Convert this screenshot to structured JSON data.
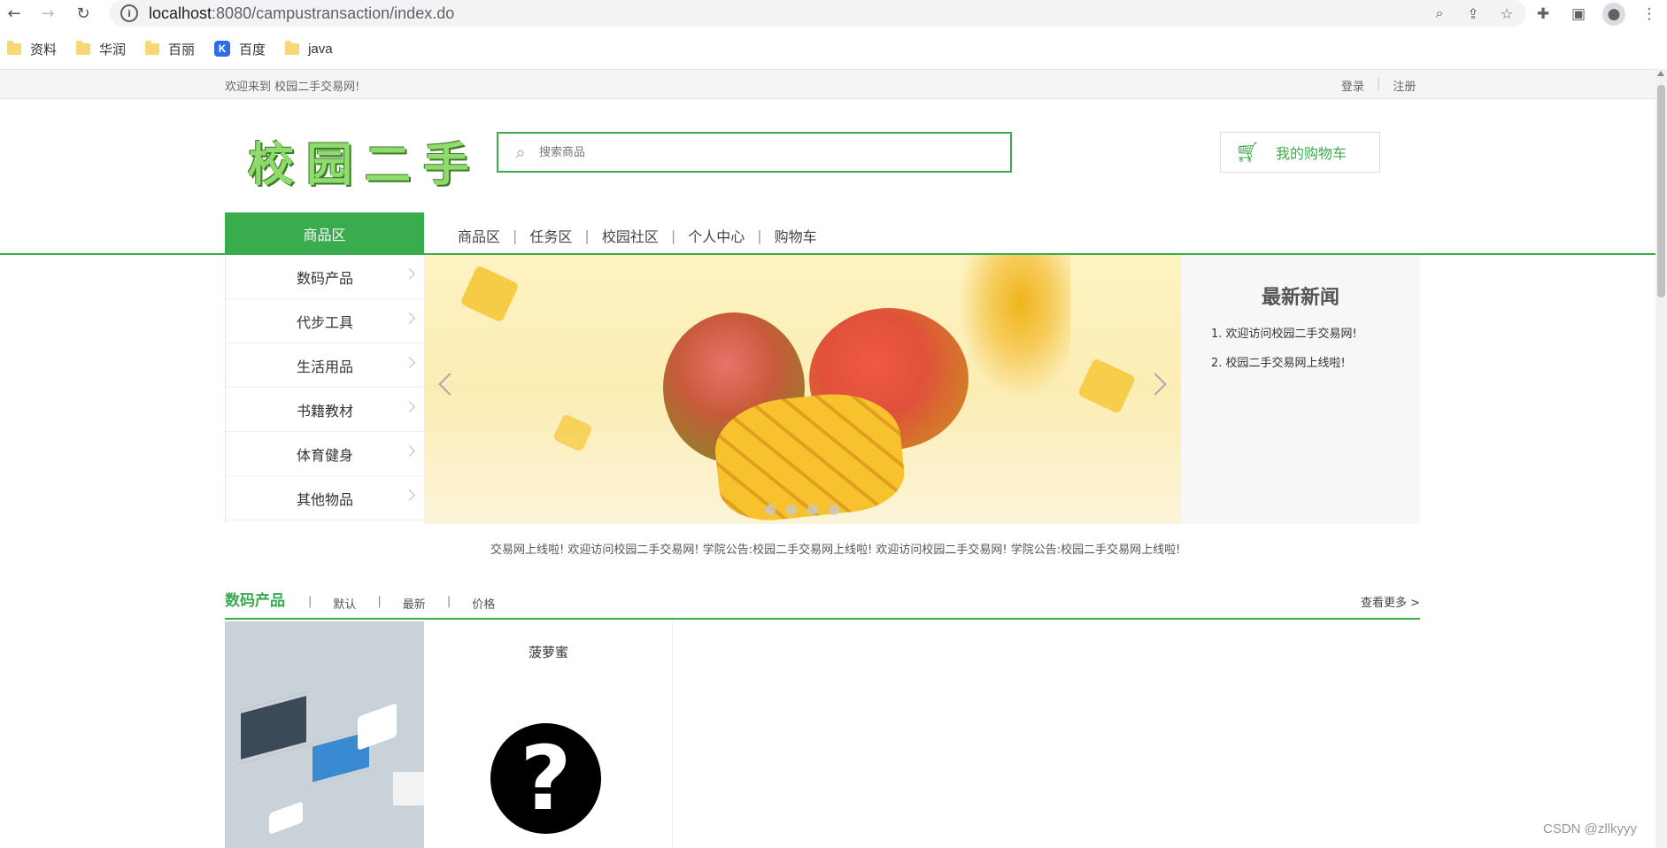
{
  "browser": {
    "url_host": "localhost",
    "url_path": ":8080/campustransaction/index.do",
    "bookmarks": [
      "资料",
      "华润",
      "百丽",
      "百度",
      "java"
    ]
  },
  "topbar": {
    "welcome": "欢迎来到 校园二手交易网!",
    "login": "登录",
    "register": "注册"
  },
  "logo": {
    "text": [
      "校",
      "园",
      "二",
      "手"
    ]
  },
  "search": {
    "placeholder": "搜索商品",
    "button": "搜索"
  },
  "cart": {
    "label": "我的购物车"
  },
  "nav": {
    "category_tab": "商品区",
    "links": [
      "商品区",
      "任务区",
      "校园社区",
      "个人中心",
      "购物车"
    ]
  },
  "sidebar": {
    "items": [
      "数码产品",
      "代步工具",
      "生活用品",
      "书籍教材",
      "体育健身",
      "其他物品"
    ]
  },
  "news": {
    "title": "最新新闻",
    "items": [
      "1. 欢迎访问校园二手交易网!",
      "2. 校园二手交易网上线啦!"
    ]
  },
  "marquee": "交易网上线啦!  欢迎访问校园二手交易网!  学院公告:校园二手交易网上线啦!  欢迎访问校园二手交易网!  学院公告:校园二手交易网上线啦!  ",
  "section": {
    "title": "数码产品",
    "sort": [
      "默认",
      "最新",
      "价格"
    ],
    "more": "查看更多 >"
  },
  "product": {
    "name": "菠萝蜜"
  },
  "watermark": "CSDN @zllkyyy",
  "colors": {
    "accent": "#39ac4e"
  }
}
